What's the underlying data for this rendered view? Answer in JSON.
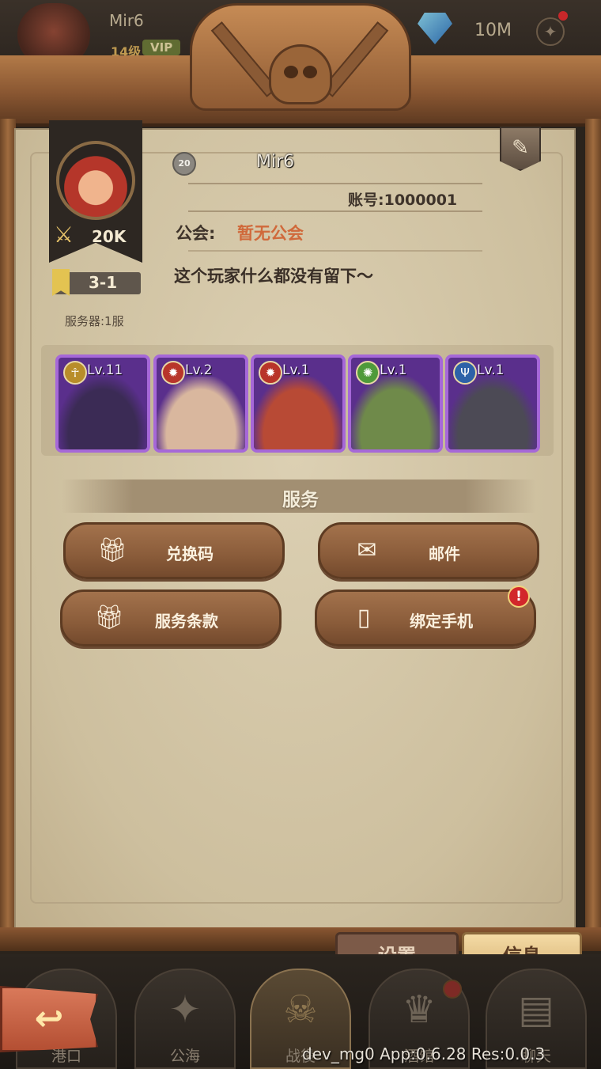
{
  "hud": {
    "player_name": "Mir6",
    "level": "14级",
    "vip": "VIP",
    "diamonds": "10M"
  },
  "profile": {
    "name": "Mir6",
    "level_badge": "20",
    "account_label": "账号:1000001",
    "guild_label": "公会:",
    "guild_value": "暂无公会",
    "bio": "这个玩家什么都没有留下～",
    "power": "20K",
    "stage": "3-1",
    "server": "服务器:1服"
  },
  "heroes": [
    {
      "level": "Lv.11",
      "faction_icon": "ankh-icon",
      "faction_color": "#b88d2a",
      "portrait_color": "#3b2b55"
    },
    {
      "level": "Lv.2",
      "faction_icon": "phoenix-icon",
      "faction_color": "#b8352a",
      "portrait_color": "#d9b79e"
    },
    {
      "level": "Lv.1",
      "faction_icon": "phoenix-icon",
      "faction_color": "#b8352a",
      "portrait_color": "#b84a35"
    },
    {
      "level": "Lv.1",
      "faction_icon": "wolf-icon",
      "faction_color": "#4f9a3a",
      "portrait_color": "#6f8a4a"
    },
    {
      "level": "Lv.1",
      "faction_icon": "trident-icon",
      "faction_color": "#2d62a8",
      "portrait_color": "#4c4a55"
    }
  ],
  "services": {
    "title": "服务",
    "redeem_code": "兑换码",
    "mail": "邮件",
    "terms": "服务条款",
    "bind_phone": "绑定手机"
  },
  "tabs": {
    "settings": "设置",
    "info": "信息"
  },
  "nav": {
    "port": "港口",
    "high_seas": "公海",
    "battle": "战役",
    "tavern": "酒馆",
    "chat": "聊天"
  },
  "debug_info": "dev_mg0 App:0.6.28 Res:0.0.3",
  "colors": {
    "accent_orange": "#d0693b",
    "hero_frame_purple": "#a668d8",
    "button_brown": "#8a5c3a",
    "active_tab": "#d9b476"
  }
}
